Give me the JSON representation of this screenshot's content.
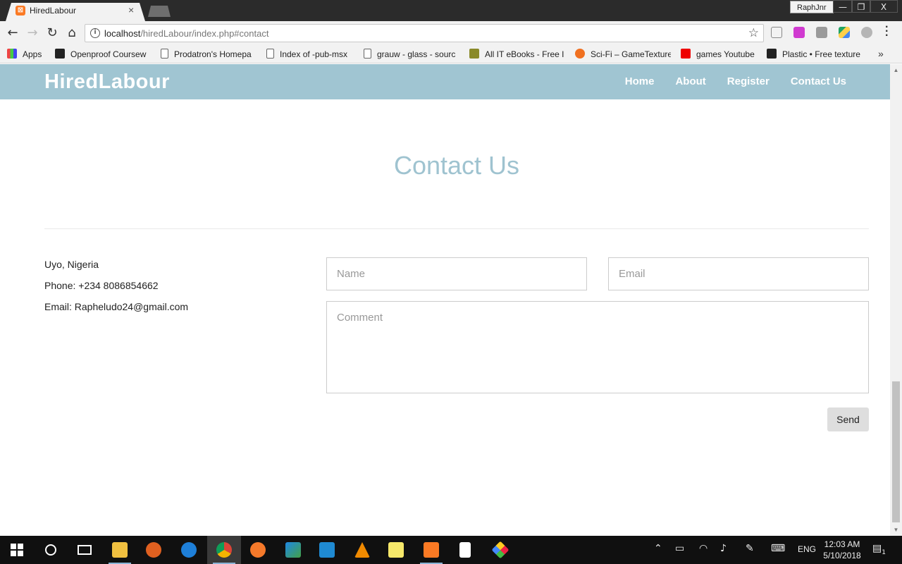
{
  "browser": {
    "tab": {
      "title": "HiredLabour"
    },
    "profile": "RaphJnr",
    "window_controls": {
      "minimize": "—",
      "restore": "❐",
      "close": "X"
    },
    "url": {
      "host": "localhost",
      "path": "/hiredLabour/index.php#contact"
    },
    "bookmarks": [
      {
        "label": "Apps",
        "icon": "apps-grid-icon"
      },
      {
        "label": "Openproof Coursew",
        "icon": "openproof-icon"
      },
      {
        "label": "Prodatron's Homepa",
        "icon": "page-icon"
      },
      {
        "label": "Index of -pub-msx",
        "icon": "page-icon"
      },
      {
        "label": "grauw - glass - sourc",
        "icon": "page-icon"
      },
      {
        "label": "All IT eBooks - Free I",
        "icon": "allitebooks-icon"
      },
      {
        "label": "Sci-Fi – GameTexture",
        "icon": "gametextures-icon"
      },
      {
        "label": "games Youtube",
        "icon": "youtube-icon"
      },
      {
        "label": "Plastic • Free texture",
        "icon": "textures-icon"
      }
    ],
    "bookmarks_overflow": "»"
  },
  "site": {
    "brand": "HiredLabour",
    "nav": [
      "Home",
      "About",
      "Register",
      "Contact Us"
    ],
    "contact": {
      "title": "Contact Us",
      "location": "Uyo, Nigeria",
      "phone": "Phone: +234 8086854662",
      "email": "Email: Rapheludo24@gmail.com",
      "form": {
        "name_placeholder": "Name",
        "email_placeholder": "Email",
        "comment_placeholder": "Comment",
        "send_label": "Send"
      }
    }
  },
  "taskbar": {
    "apps": [
      "start-icon",
      "cortana-icon",
      "task-view-icon",
      "file-explorer-icon",
      "sketchup-icon",
      "edge-icon",
      "chrome-icon",
      "blender-icon",
      "webstorm-icon",
      "vscode-icon",
      "vlc-icon",
      "sticky-notes-icon",
      "xampp-icon",
      "notepad-icon",
      "git-icon"
    ],
    "language": "ENG",
    "time": "12:03 AM",
    "date": "5/10/2018",
    "notification_count": "1"
  },
  "colors": {
    "nav_bg": "#a0c5d2",
    "title_color": "#9fc3d0",
    "send_bg": "#dedede"
  }
}
